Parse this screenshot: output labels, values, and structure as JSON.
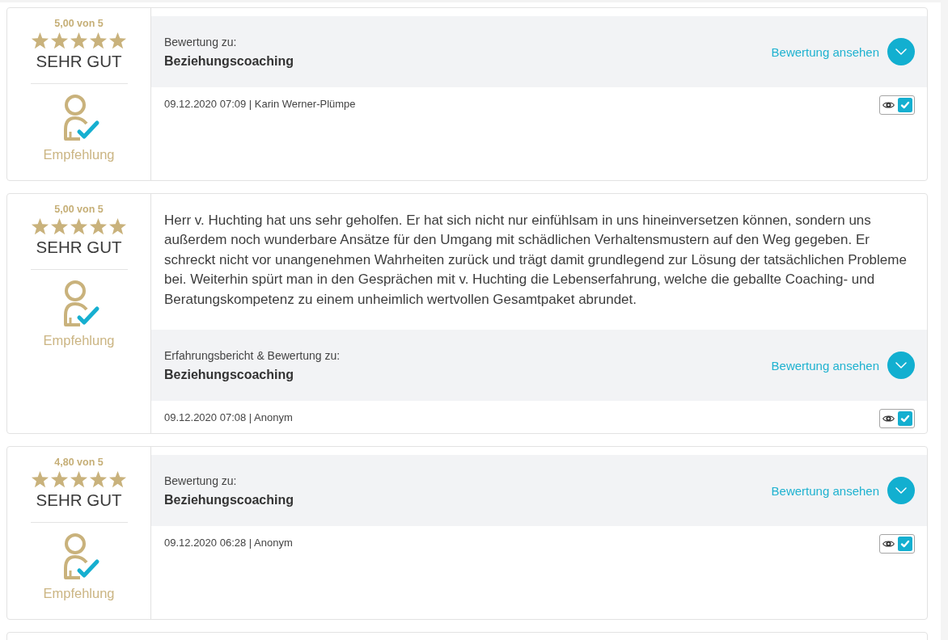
{
  "reviews": [
    {
      "score": "5,00 von 5",
      "stars": 5,
      "grade": "SEHR GUT",
      "recommendation": "Empfehlung",
      "header_label": "Bewertung zu:",
      "subject": "Beziehungscoaching",
      "link": "Bewertung ansehen",
      "meta": "09.12.2020 07:09 | Karin Werner-Plümpe",
      "checked": true
    },
    {
      "score": "5,00 von 5",
      "stars": 5,
      "grade": "SEHR GUT",
      "recommendation": "Empfehlung",
      "text": "Herr v. Huchting hat uns sehr geholfen. Er hat sich nicht nur einfühlsam in uns hineinversetzen können, sondern uns außerdem noch wunderbare Ansätze für den Umgang mit schädlichen Verhaltensmustern auf den Weg gegeben. Er schreckt nicht vor unangenehmen Wahrheiten zurück und trägt damit grundlegend zur Lösung der tatsächlichen Probleme bei. Weiterhin spürt man in den Gesprächen mit v. Huchting die Lebenserfahrung, welche die geballte Coaching- und Beratungskompetenz zu einem unheimlich wertvollen Gesamtpaket abrundet.",
      "header_label": "Erfahrungsbericht & Bewertung zu:",
      "subject": "Beziehungscoaching",
      "link": "Bewertung ansehen",
      "meta": "09.12.2020 07:08 | Anonym",
      "checked": true
    },
    {
      "score": "4,80 von 5",
      "stars": 5,
      "grade": "SEHR GUT",
      "recommendation": "Empfehlung",
      "header_label": "Bewertung zu:",
      "subject": "Beziehungscoaching",
      "link": "Bewertung ansehen",
      "meta": "09.12.2020 06:28 | Anonym",
      "checked": true
    }
  ]
}
